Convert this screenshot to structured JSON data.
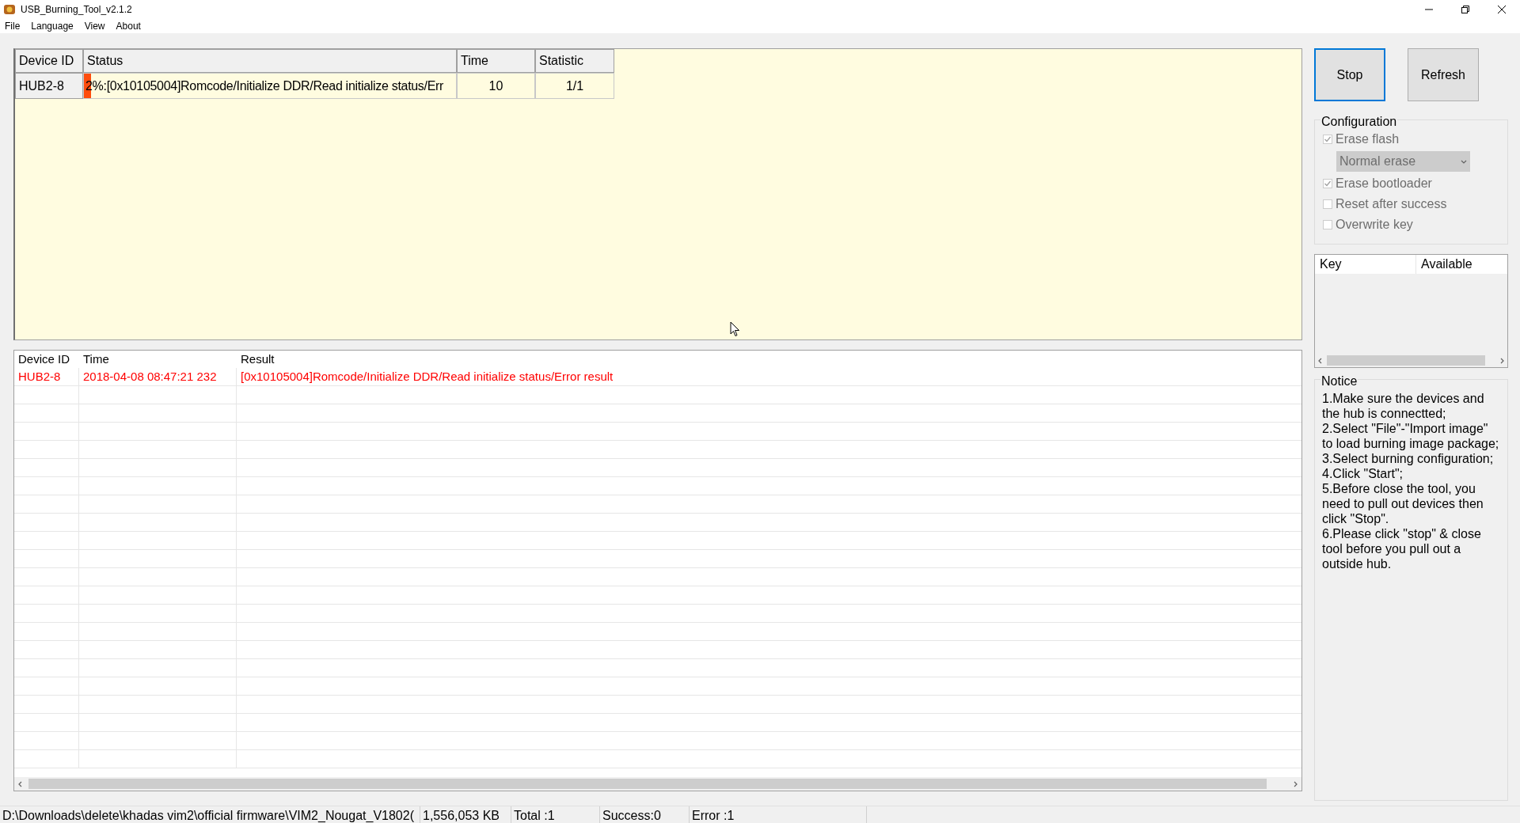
{
  "window": {
    "title": "USB_Burning_Tool_v2.1.2"
  },
  "menu": [
    "File",
    "Language",
    "View",
    "About"
  ],
  "devices": {
    "columns": [
      "Device ID",
      "Status",
      "Time",
      "Statistic"
    ],
    "rows": [
      {
        "device_id": "HUB2-8",
        "status": "2%:[0x10105004]Romcode/Initialize DDR/Read initialize status/Err",
        "level": 0.02,
        "time": "10",
        "statistic": "1/1"
      }
    ]
  },
  "log": {
    "columns": [
      "Device ID",
      "Time",
      "Result"
    ],
    "rows": [
      {
        "kind": "error",
        "device_id": "HUB2-8",
        "time": "2018-04-08 08:47:21 232",
        "result": "[0x10105004]Romcode/Initialize DDR/Read initialize status/Error result"
      }
    ]
  },
  "buttons": [
    {
      "label": "Stop",
      "selected": true
    },
    {
      "label": "Refresh",
      "selected": false
    }
  ],
  "configuration": {
    "title": "Configuration",
    "items": [
      {
        "kind": "checkbox",
        "label": "Erase flash",
        "checked": true,
        "disabled": true
      },
      {
        "kind": "dropdown",
        "value": "Normal erase",
        "disabled": true
      },
      {
        "kind": "checkbox",
        "label": "Erase bootloader",
        "checked": true,
        "disabled": true
      },
      {
        "kind": "checkbox",
        "label": "Reset after success",
        "checked": false,
        "disabled": true
      },
      {
        "kind": "checkbox",
        "label": "Overwrite key",
        "checked": false,
        "disabled": true
      }
    ]
  },
  "keys": {
    "columns": [
      "Key",
      "Available"
    ]
  },
  "notice": {
    "title": "Notice",
    "text": "1.Make sure the devices and the hub is connectted;\n2.Select \"File\"-\"Import image\" to load burning image package;\n3.Select burning configuration;\n4.Click \"Start\";\n5.Before close the tool, you need to pull out devices then click \"Stop\".\n6.Please click \"stop\" & close tool before you pull out a outside hub."
  },
  "status_bar": [
    "D:\\Downloads\\delete\\khadas vim2\\official firmware\\VIM2_Nougat_V1802(",
    "1,556,053 KB",
    "Total :1",
    "Success:0",
    "Error :1"
  ]
}
